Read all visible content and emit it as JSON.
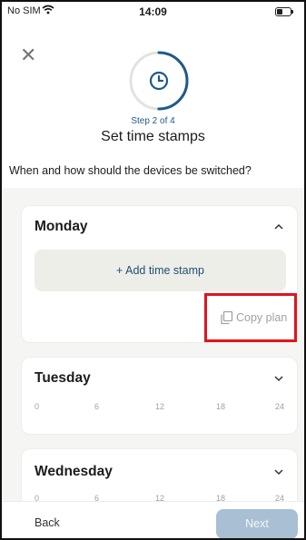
{
  "status_bar": {
    "carrier": "No SIM",
    "time": "14:09"
  },
  "header": {
    "step_label": "Step 2 of 4",
    "title": "Set time stamps",
    "subtitle": "When and how should the devices be switched?"
  },
  "progress": {
    "step": 2,
    "total": 4,
    "fraction": 0.5
  },
  "days": [
    {
      "name": "Monday",
      "expanded": true,
      "add_label": "+ Add time stamp",
      "copy_label": "Copy plan"
    },
    {
      "name": "Tuesday",
      "expanded": false,
      "axis": [
        "0",
        "6",
        "12",
        "18",
        "24"
      ]
    },
    {
      "name": "Wednesday",
      "expanded": false,
      "axis": [
        "0",
        "6",
        "12",
        "18",
        "24"
      ]
    }
  ],
  "footer": {
    "back_label": "Back",
    "next_label": "Next"
  },
  "colors": {
    "accent": "#1e5a8c",
    "highlight": "#e0141e",
    "next_disabled": "#a8bfd4"
  }
}
